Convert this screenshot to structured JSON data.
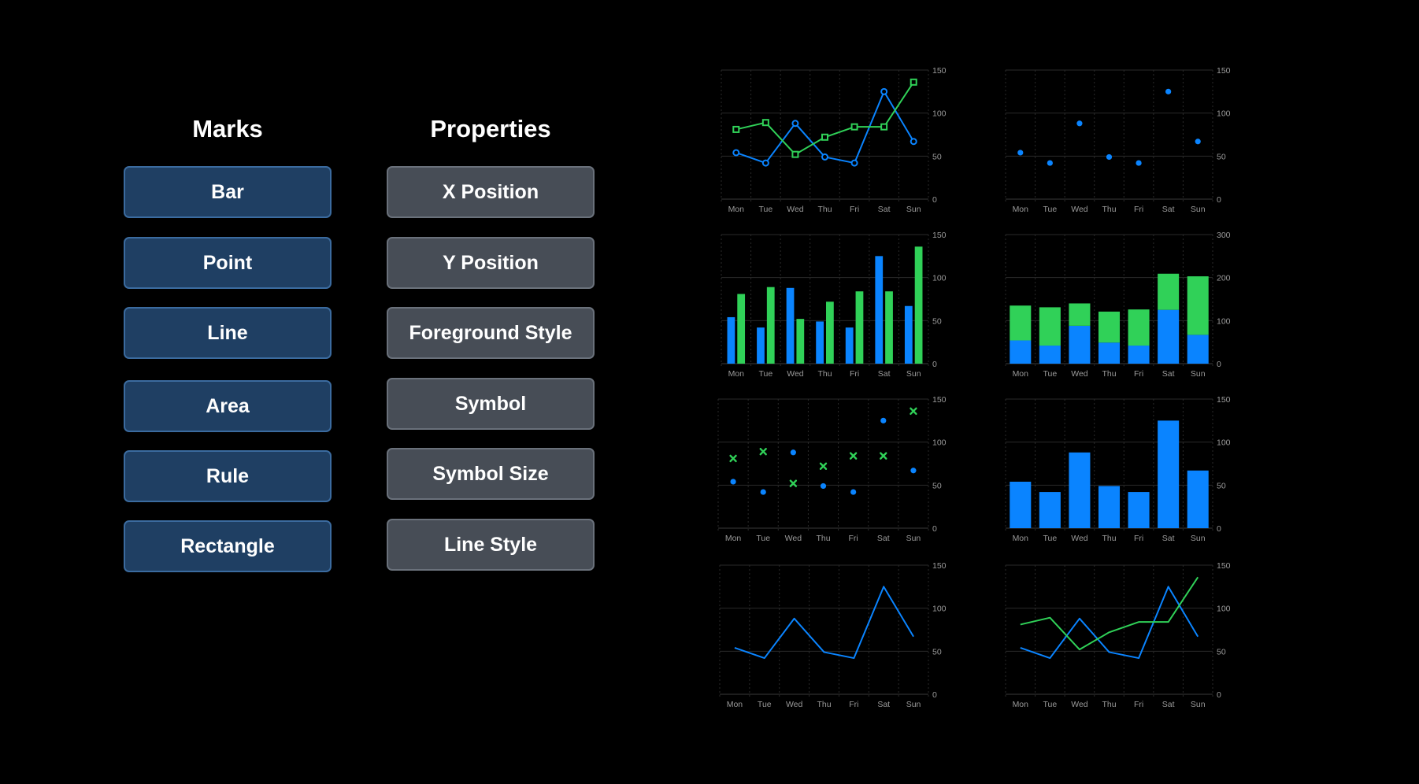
{
  "marks": {
    "title": "Marks",
    "items": [
      "Bar",
      "Point",
      "Line",
      "Area",
      "Rule",
      "Rectangle"
    ]
  },
  "properties": {
    "title": "Properties",
    "items": [
      "X Position",
      "Y Position",
      "Foreground Style",
      "Symbol",
      "Symbol Size",
      "Line Style"
    ]
  },
  "colors": {
    "background": "#000000",
    "blue": "#0a84ff",
    "green": "#30d158",
    "mark_fill": "#1f3f63",
    "property_fill": "#474d56"
  },
  "chart_data": [
    {
      "type": "line",
      "id": "line-two-series-with-symbols",
      "categories": [
        "Mon",
        "Tue",
        "Wed",
        "Thu",
        "Fri",
        "Sat",
        "Sun"
      ],
      "series": [
        {
          "color": "#0a84ff",
          "symbol": "circle",
          "values": [
            54,
            42,
            88,
            49,
            42,
            125,
            67
          ]
        },
        {
          "color": "#30d158",
          "symbol": "square",
          "values": [
            81,
            89,
            52,
            72,
            84,
            84,
            136
          ]
        }
      ],
      "ylim": [
        0,
        150
      ],
      "yticks": [
        0,
        50,
        100,
        150
      ],
      "grid": true
    },
    {
      "type": "scatter",
      "id": "point-single-series",
      "categories": [
        "Mon",
        "Tue",
        "Wed",
        "Thu",
        "Fri",
        "Sat",
        "Sun"
      ],
      "series": [
        {
          "color": "#0a84ff",
          "symbol": "circle",
          "values": [
            54,
            42,
            88,
            49,
            42,
            125,
            67
          ]
        }
      ],
      "ylim": [
        0,
        150
      ],
      "yticks": [
        0,
        50,
        100,
        150
      ],
      "grid": true
    },
    {
      "type": "bar",
      "id": "bar-grouped",
      "categories": [
        "Mon",
        "Tue",
        "Wed",
        "Thu",
        "Fri",
        "Sat",
        "Sun"
      ],
      "series": [
        {
          "color": "#0a84ff",
          "values": [
            54,
            42,
            88,
            49,
            42,
            125,
            67
          ]
        },
        {
          "color": "#30d158",
          "values": [
            81,
            89,
            52,
            72,
            84,
            84,
            136
          ]
        }
      ],
      "ylim": [
        0,
        150
      ],
      "yticks": [
        0,
        50,
        100,
        150
      ],
      "grid": true
    },
    {
      "type": "bar",
      "id": "bar-stacked",
      "stacked": true,
      "categories": [
        "Mon",
        "Tue",
        "Wed",
        "Thu",
        "Fri",
        "Sat",
        "Sun"
      ],
      "series": [
        {
          "color": "#0a84ff",
          "values": [
            54,
            42,
            88,
            49,
            42,
            125,
            67
          ]
        },
        {
          "color": "#30d158",
          "values": [
            81,
            89,
            52,
            72,
            84,
            84,
            136
          ]
        }
      ],
      "ylim": [
        0,
        300
      ],
      "yticks": [
        0,
        100,
        200,
        300
      ],
      "grid": true
    },
    {
      "type": "scatter",
      "id": "point-two-series-symbols",
      "categories": [
        "Mon",
        "Tue",
        "Wed",
        "Thu",
        "Fri",
        "Sat",
        "Sun"
      ],
      "series": [
        {
          "color": "#0a84ff",
          "symbol": "circle",
          "values": [
            54,
            42,
            88,
            49,
            42,
            125,
            67
          ]
        },
        {
          "color": "#30d158",
          "symbol": "cross",
          "values": [
            81,
            89,
            52,
            72,
            84,
            84,
            136
          ]
        }
      ],
      "ylim": [
        0,
        150
      ],
      "yticks": [
        0,
        50,
        100,
        150
      ],
      "grid": true
    },
    {
      "type": "bar",
      "id": "bar-single-series",
      "categories": [
        "Mon",
        "Tue",
        "Wed",
        "Thu",
        "Fri",
        "Sat",
        "Sun"
      ],
      "series": [
        {
          "color": "#0a84ff",
          "values": [
            54,
            42,
            88,
            49,
            42,
            125,
            67
          ]
        }
      ],
      "ylim": [
        0,
        150
      ],
      "yticks": [
        0,
        50,
        100,
        150
      ],
      "grid": true
    },
    {
      "type": "line",
      "id": "line-single-series",
      "categories": [
        "Mon",
        "Tue",
        "Wed",
        "Thu",
        "Fri",
        "Sat",
        "Sun"
      ],
      "series": [
        {
          "color": "#0a84ff",
          "values": [
            54,
            42,
            88,
            49,
            42,
            125,
            67
          ]
        }
      ],
      "ylim": [
        0,
        150
      ],
      "yticks": [
        0,
        50,
        100,
        150
      ],
      "grid": true
    },
    {
      "type": "line",
      "id": "line-two-series",
      "categories": [
        "Mon",
        "Tue",
        "Wed",
        "Thu",
        "Fri",
        "Sat",
        "Sun"
      ],
      "series": [
        {
          "color": "#0a84ff",
          "values": [
            54,
            42,
            88,
            49,
            42,
            125,
            67
          ]
        },
        {
          "color": "#30d158",
          "values": [
            81,
            89,
            52,
            72,
            84,
            84,
            136
          ]
        }
      ],
      "ylim": [
        0,
        150
      ],
      "yticks": [
        0,
        50,
        100,
        150
      ],
      "grid": true
    }
  ]
}
